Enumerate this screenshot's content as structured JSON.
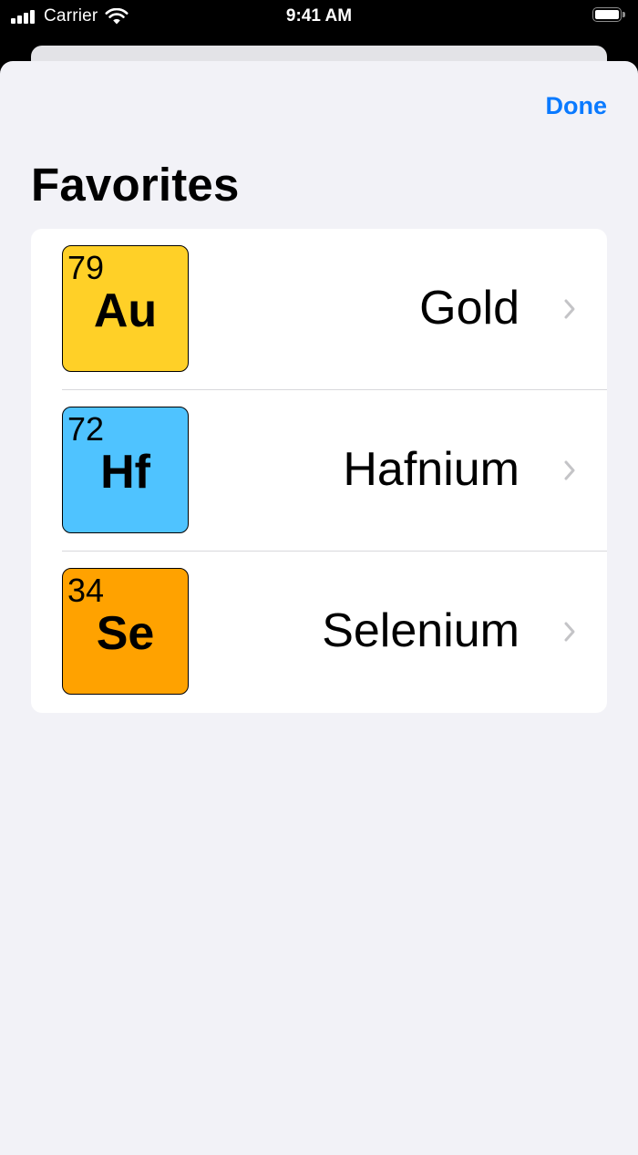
{
  "status_bar": {
    "carrier": "Carrier",
    "time": "9:41 AM",
    "icons": [
      "signal-icon",
      "wifi-icon",
      "battery-icon"
    ]
  },
  "nav": {
    "done_label": "Done",
    "title": "Favorites"
  },
  "favorites": [
    {
      "number": "79",
      "symbol": "Au",
      "name": "Gold",
      "color": "#ffd027"
    },
    {
      "number": "72",
      "symbol": "Hf",
      "name": "Hafnium",
      "color": "#4fc3ff"
    },
    {
      "number": "34",
      "symbol": "Se",
      "name": "Selenium",
      "color": "#ffa200"
    }
  ],
  "colors": {
    "accent": "#0a7aff",
    "sheet_background": "#f2f2f7",
    "chevron": "#c4c4c7"
  }
}
